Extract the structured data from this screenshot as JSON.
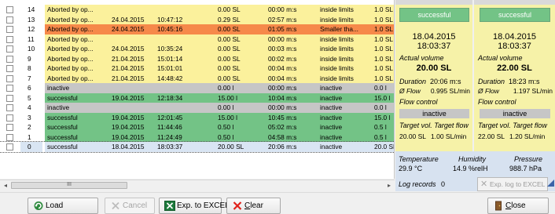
{
  "table": {
    "rows": [
      {
        "index": "14",
        "status": "Aborted by op...",
        "date": "",
        "time": "",
        "volume": "0.00 SL",
        "duration": "00:00 m:s",
        "limits": "inside limits",
        "last": "1.0 SL",
        "color": "yellow"
      },
      {
        "index": "13",
        "status": "Aborted by op...",
        "date": "24.04.2015",
        "time": "10:47:12",
        "volume": "0.29 SL",
        "duration": "02:57 m:s",
        "limits": "inside limits",
        "last": "1.0 SL",
        "color": "yellow"
      },
      {
        "index": "12",
        "status": "Aborted by op...",
        "date": "24.04.2015",
        "time": "10:45:16",
        "volume": "0.00 SL",
        "duration": "01:05 m:s",
        "limits": "Smaller tha...",
        "last": "1.0 SL",
        "color": "orange"
      },
      {
        "index": "11",
        "status": "Aborted by op...",
        "date": "",
        "time": "",
        "volume": "0.00 SL",
        "duration": "00:00 m:s",
        "limits": "inside limits",
        "last": "1.0 SL",
        "color": "yellow"
      },
      {
        "index": "10",
        "status": "Aborted by op...",
        "date": "24.04.2015",
        "time": "10:35:24",
        "volume": "0.00 SL",
        "duration": "00:03 m:s",
        "limits": "inside limits",
        "last": "1.0 SL",
        "color": "yellow"
      },
      {
        "index": "9",
        "status": "Aborted by op...",
        "date": "21.04.2015",
        "time": "15:01:14",
        "volume": "0.00 SL",
        "duration": "00:02 m:s",
        "limits": "inside limits",
        "last": "1.0 SL",
        "color": "yellow"
      },
      {
        "index": "8",
        "status": "Aborted by op...",
        "date": "21.04.2015",
        "time": "15:01:01",
        "volume": "0.00 SL",
        "duration": "00:04 m:s",
        "limits": "inside limits",
        "last": "1.0 SL",
        "color": "yellow"
      },
      {
        "index": "7",
        "status": "Aborted by op...",
        "date": "21.04.2015",
        "time": "14:48:42",
        "volume": "0.00 SL",
        "duration": "00:04 m:s",
        "limits": "inside limits",
        "last": "1.0 SL",
        "color": "yellow"
      },
      {
        "index": "6",
        "status": "inactive",
        "date": "",
        "time": "",
        "volume": "0.00 l",
        "duration": "00:00 m:s",
        "limits": "inactive",
        "last": "0.0 l",
        "color": "gray"
      },
      {
        "index": "5",
        "status": "successful",
        "date": "19.04.2015",
        "time": "12:18:34",
        "volume": "15.00 l",
        "duration": "10:04 m:s",
        "limits": "inactive",
        "last": "15.0 l",
        "color": "green"
      },
      {
        "index": "4",
        "status": "inactive",
        "date": "",
        "time": "",
        "volume": "0.00 l",
        "duration": "00:00 m:s",
        "limits": "inactive",
        "last": "0.0 l",
        "color": "gray"
      },
      {
        "index": "3",
        "status": "successful",
        "date": "19.04.2015",
        "time": "12:01:45",
        "volume": "15.00 l",
        "duration": "10:45 m:s",
        "limits": "inactive",
        "last": "15.0 l",
        "color": "green"
      },
      {
        "index": "2",
        "status": "successful",
        "date": "19.04.2015",
        "time": "11:44:46",
        "volume": "0.50 l",
        "duration": "05:02 m:s",
        "limits": "inactive",
        "last": "0.5 l",
        "color": "green"
      },
      {
        "index": "1",
        "status": "successful",
        "date": "19.04.2015",
        "time": "11:24:49",
        "volume": "0.50 l",
        "duration": "04:58 m:s",
        "limits": "inactive",
        "last": "0.5 l",
        "color": "green"
      },
      {
        "index": "0",
        "status": "successful",
        "date": "18.04.2015",
        "time": "18:03:37",
        "volume": "20.00 SL",
        "duration": "20:06 m:s",
        "limits": "inactive",
        "last": "20.0 SL",
        "color": "selected"
      }
    ],
    "scroll_thumb_label": "III"
  },
  "channelA": {
    "result": "successful",
    "date": "18.04.2015",
    "time": "18:03:37",
    "actual_volume_label": "Actual volume",
    "actual_volume": "20.00 SL",
    "duration_label": "Duration",
    "duration": "20:06 m:s",
    "flow_label": "Ø Flow",
    "flow": "0.995 SL/min",
    "flow_control_label": "Flow control",
    "flow_control": "inactive",
    "target_labels": "Target vol. Target flow",
    "target_vol": "20.00 SL",
    "target_flow": "1.00 SL/min"
  },
  "channelB": {
    "result": "successful",
    "date": "18.04.2015",
    "time": "18:03:37",
    "actual_volume_label": "Actual volume",
    "actual_volume": "22.00 SL",
    "duration_label": "Duration",
    "duration": "18:23 m:s",
    "flow_label": "Ø Flow",
    "flow": "1.197 SL/min",
    "flow_control_label": "Flow control",
    "flow_control": "inactive",
    "target_labels": "Target vol. Target flow",
    "target_vol": "22.00 SL",
    "target_flow": "1.20 SL/min"
  },
  "environment": {
    "temperature_label": "Temperature",
    "temperature": "29.9 °C",
    "humidity_label": "Humidity",
    "humidity": "14.9 %relH",
    "pressure_label": "Pressure",
    "pressure": "988.7 hPa",
    "log_records_label": "Log records",
    "log_records": "0",
    "export_log_label": "Exp. log to EXCEL"
  },
  "buttons": {
    "load": "Load",
    "cancel": "Cancel",
    "export_excel": "Exp. to EXCEL",
    "clear_first": "C",
    "clear_rest": "lear",
    "close_first": "C",
    "close_rest": "lose"
  },
  "colors": {
    "row_yellow": "#fbf19c",
    "row_orange": "#f6894a",
    "row_gray": "#c6c6c6",
    "row_green": "#73c386",
    "row_selected": "#d9e5f3",
    "panel_yellow": "#f6f2a8",
    "panel_blue": "#d7e2f0"
  },
  "icons": {
    "load": "refresh-icon",
    "cancel": "cancel-x-icon",
    "export_excel": "excel-icon",
    "clear": "red-x-icon",
    "close": "exit-door-icon"
  }
}
